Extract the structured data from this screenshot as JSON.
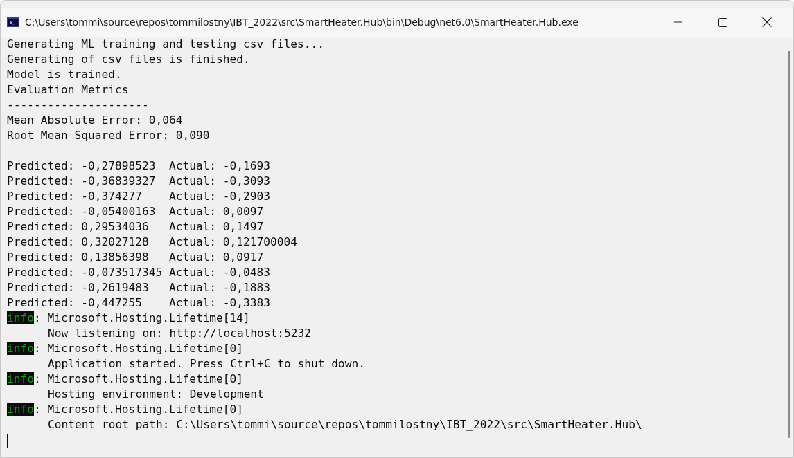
{
  "window": {
    "title": "C:\\Users\\tommi\\source\\repos\\tommilostny\\IBT_2022\\src\\SmartHeater.Hub\\bin\\Debug\\net6.0\\SmartHeater.Hub.exe"
  },
  "console": {
    "lines": [
      {
        "kind": "text",
        "text": "Generating ML training and testing csv files..."
      },
      {
        "kind": "text",
        "text": "Generating of csv files is finished."
      },
      {
        "kind": "text",
        "text": "Model is trained."
      },
      {
        "kind": "text",
        "text": "Evaluation Metrics"
      },
      {
        "kind": "text",
        "text": "---------------------"
      },
      {
        "kind": "text",
        "text": "Mean Absolute Error: 0,064"
      },
      {
        "kind": "text",
        "text": "Root Mean Squared Error: 0,090"
      },
      {
        "kind": "blank"
      },
      {
        "kind": "text",
        "text": "Predicted: -0,27898523  Actual: -0,1693"
      },
      {
        "kind": "text",
        "text": "Predicted: -0,36839327  Actual: -0,3093"
      },
      {
        "kind": "text",
        "text": "Predicted: -0,374277    Actual: -0,2903"
      },
      {
        "kind": "text",
        "text": "Predicted: -0,05400163  Actual: 0,0097"
      },
      {
        "kind": "text",
        "text": "Predicted: 0,29534036   Actual: 0,1497"
      },
      {
        "kind": "text",
        "text": "Predicted: 0,32027128   Actual: 0,121700004"
      },
      {
        "kind": "text",
        "text": "Predicted: 0,13856398   Actual: 0,0917"
      },
      {
        "kind": "text",
        "text": "Predicted: -0,073517345 Actual: -0,0483"
      },
      {
        "kind": "text",
        "text": "Predicted: -0,2619483   Actual: -0,1883"
      },
      {
        "kind": "text",
        "text": "Predicted: -0,447255    Actual: -0,3383"
      },
      {
        "kind": "log",
        "level": "info",
        "text": ": Microsoft.Hosting.Lifetime[14]"
      },
      {
        "kind": "indented",
        "text": "Now listening on: http://localhost:5232"
      },
      {
        "kind": "log",
        "level": "info",
        "text": ": Microsoft.Hosting.Lifetime[0]"
      },
      {
        "kind": "indented",
        "text": "Application started. Press Ctrl+C to shut down."
      },
      {
        "kind": "log",
        "level": "info",
        "text": ": Microsoft.Hosting.Lifetime[0]"
      },
      {
        "kind": "indented",
        "text": "Hosting environment: Development"
      },
      {
        "kind": "log",
        "level": "info",
        "text": ": Microsoft.Hosting.Lifetime[0]"
      },
      {
        "kind": "indented",
        "text": "Content root path: C:\\Users\\tommi\\source\\repos\\tommilostny\\IBT_2022\\src\\SmartHeater.Hub\\"
      }
    ]
  }
}
